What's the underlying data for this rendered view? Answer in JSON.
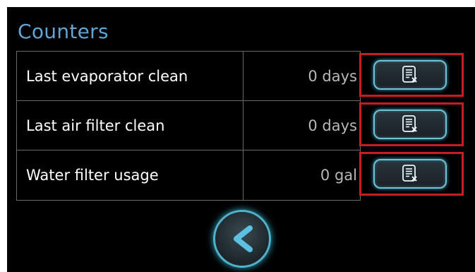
{
  "screen": {
    "title": "Counters"
  },
  "counters": [
    {
      "label": "Last evaporator clean",
      "value": "0 days",
      "reset_icon": "reset-document-icon"
    },
    {
      "label": "Last air filter clean",
      "value": "0 days",
      "reset_icon": "reset-document-icon"
    },
    {
      "label": "Water filter usage",
      "value": "0 gal",
      "reset_icon": "reset-document-icon"
    }
  ],
  "navigation": {
    "back_icon": "chevron-left-icon"
  },
  "colors": {
    "background": "#000000",
    "title": "#5fa5d6",
    "button_glow": "#6fc3d8",
    "highlight_border": "#c61c22",
    "grid_line": "#6a6a6a"
  }
}
